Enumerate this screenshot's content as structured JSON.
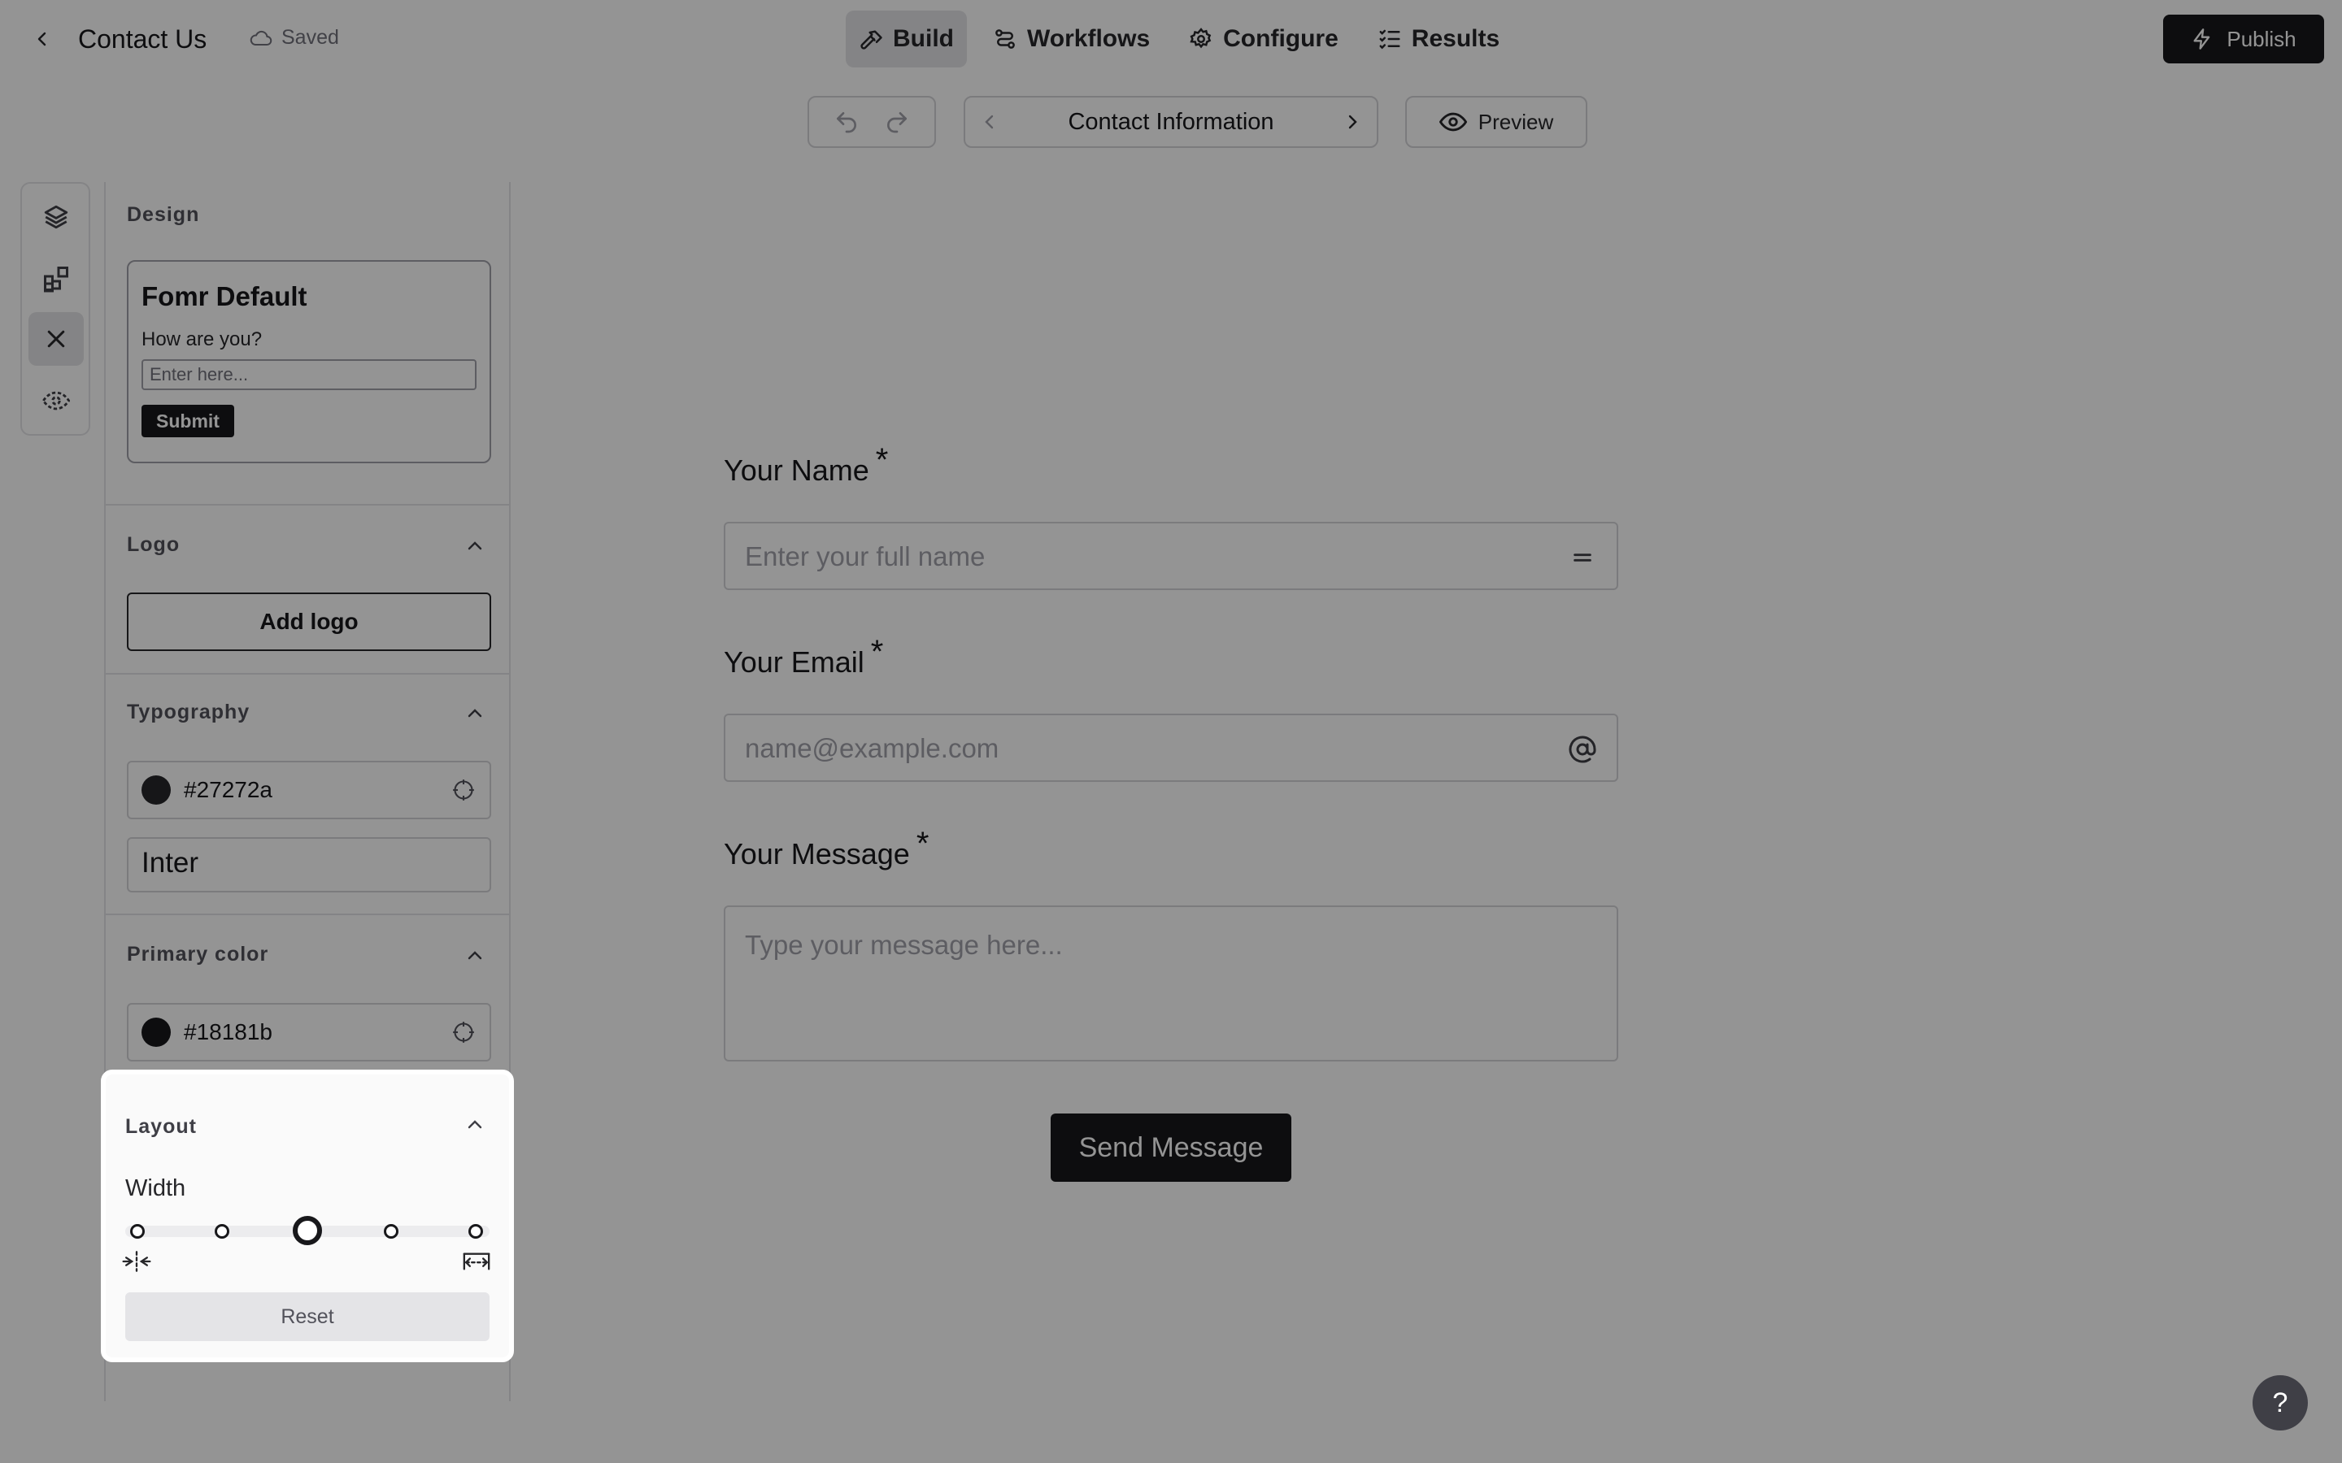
{
  "header": {
    "title": "Contact Us",
    "saved_label": "Saved",
    "publish_label": "Publish"
  },
  "nav": {
    "tabs": [
      {
        "label": "Build",
        "icon": "hammer-icon",
        "active": true
      },
      {
        "label": "Workflows",
        "icon": "workflow-icon",
        "active": false
      },
      {
        "label": "Configure",
        "icon": "gear-icon",
        "active": false
      },
      {
        "label": "Results",
        "icon": "list-check-icon",
        "active": false
      }
    ]
  },
  "toolbar": {
    "page_title": "Contact Information",
    "preview_label": "Preview"
  },
  "rail": {
    "items": [
      {
        "icon": "layers-icon",
        "active": false
      },
      {
        "icon": "add-blocks-icon",
        "active": false
      },
      {
        "icon": "close-icon",
        "active": true
      },
      {
        "icon": "eye-icon",
        "active": false
      }
    ]
  },
  "design": {
    "section_title": "Design",
    "theme_card": {
      "name": "Fomr Default",
      "question": "How are you?",
      "placeholder": "Enter here...",
      "button": "Submit"
    },
    "logo": {
      "title": "Logo",
      "button": "Add logo"
    },
    "typography": {
      "title": "Typography",
      "color": "#27272a",
      "font": "Inter"
    },
    "primary": {
      "title": "Primary color",
      "color": "#18181b"
    },
    "layout": {
      "title": "Layout",
      "width_label": "Width",
      "width_stops": 5,
      "width_selected_index": 2,
      "reset_label": "Reset"
    }
  },
  "form": {
    "fields": [
      {
        "label": "Your Name",
        "required": "*",
        "placeholder": "Enter your full name",
        "icon": "equals-icon"
      },
      {
        "label": "Your Email",
        "required": "*",
        "placeholder": "name@example.com",
        "icon": "at-sign-icon"
      },
      {
        "label": "Your Message",
        "required": "*",
        "placeholder": "Type your message here..."
      }
    ],
    "submit_label": "Send Message"
  },
  "help": {
    "label": "?"
  }
}
